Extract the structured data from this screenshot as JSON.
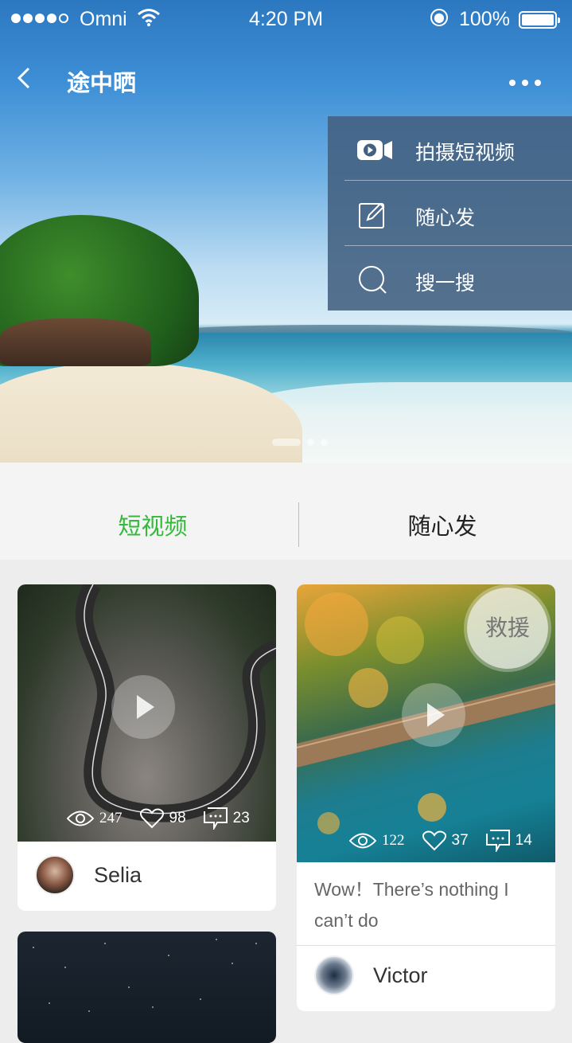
{
  "status_bar": {
    "carrier": "Omni",
    "time": "4:20 PM",
    "battery": "100%"
  },
  "nav": {
    "title": "途中晒"
  },
  "menu": {
    "items": [
      {
        "label": "拍摄短视频",
        "icon": "video-camera-icon"
      },
      {
        "label": "随心发",
        "icon": "edit-icon"
      },
      {
        "label": "搜一搜",
        "icon": "search-icon"
      }
    ]
  },
  "tabs": [
    {
      "label": "短视频",
      "active": true
    },
    {
      "label": "随心发",
      "active": false
    }
  ],
  "accent_color": "#35b93b",
  "cards": [
    {
      "views": "247",
      "likes": "98",
      "comments": "23",
      "author": "Selia"
    },
    {
      "views": "122",
      "likes": "37",
      "comments": "14",
      "caption": "Wow！There’s nothing I can’t do",
      "author": "Victor"
    }
  ],
  "floating_button": {
    "label": "救援"
  }
}
